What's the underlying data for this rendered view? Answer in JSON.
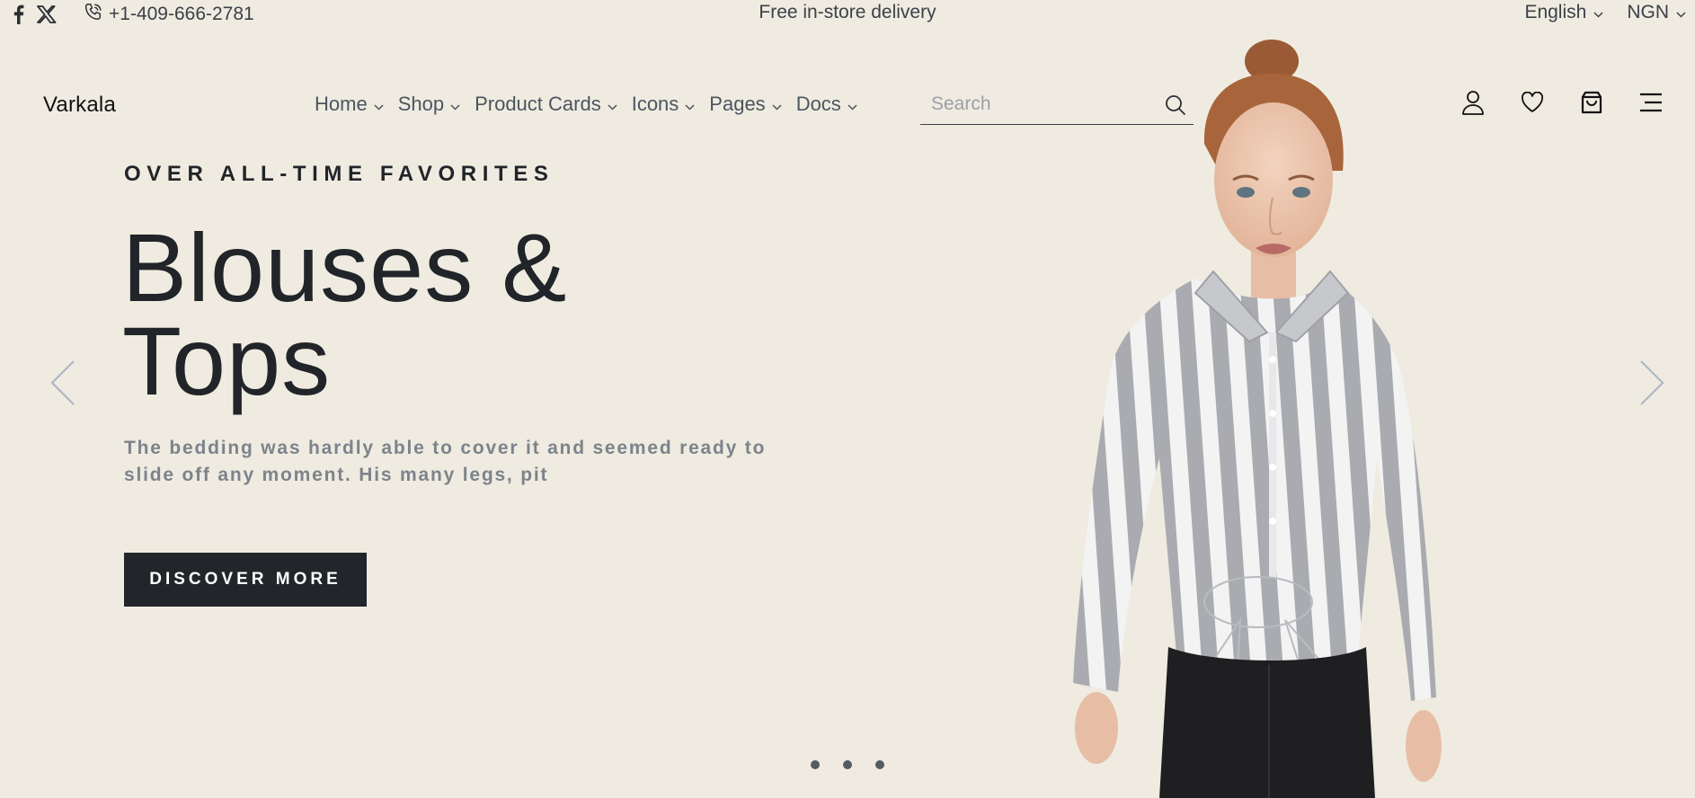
{
  "topbar": {
    "social": [
      {
        "icon": "facebook-icon"
      },
      {
        "icon": "x-twitter-icon"
      }
    ],
    "phone_icon": "phone-icon",
    "phone": "+1-409-666-2781",
    "promo": "Free in-store delivery",
    "language": "English",
    "currency": "NGN"
  },
  "header": {
    "logo": "Varkala",
    "nav": [
      {
        "label": "Home"
      },
      {
        "label": "Shop"
      },
      {
        "label": "Product Cards"
      },
      {
        "label": "Icons"
      },
      {
        "label": "Pages"
      },
      {
        "label": "Docs"
      }
    ],
    "search": {
      "placeholder": "Search",
      "value": ""
    },
    "icons": [
      "user-icon",
      "heart-icon",
      "shopping-bag-icon",
      "menu-icon"
    ]
  },
  "hero": {
    "eyebrow": "OVER ALL-TIME FAVORITES",
    "title_line1": "Blouses &",
    "title_line2": "Tops",
    "text": "The bedding was hardly able to cover it and seemed ready to slide off any moment. His many legs, pit",
    "cta": "DISCOVER MORE",
    "slides": 3,
    "active_slide": 1
  },
  "colors": {
    "background": "#efebe0",
    "text_dark": "#212529",
    "text_muted": "#7c838b",
    "button_bg": "#222529",
    "button_text": "#ffffff"
  }
}
